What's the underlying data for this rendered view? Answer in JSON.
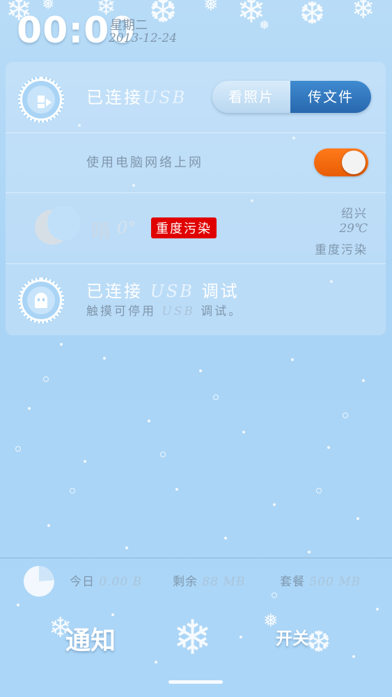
{
  "status": {
    "time": "00:00",
    "weekday": "星期二",
    "date": "2013-12-24"
  },
  "usb": {
    "label_cn": "已连接",
    "label_usb": "USB",
    "tab_photos": "看照片",
    "tab_files": "传文件",
    "selected_tab": "传文件"
  },
  "network": {
    "label": "使用电脑网络上网",
    "toggle_on": true
  },
  "weather": {
    "condition": "晴",
    "temperature": "0°",
    "aqi_badge": "重度污染",
    "city": "绍兴",
    "city_temp": "29℃",
    "city_aqi": "重度污染"
  },
  "debug": {
    "title_cn": "已连接",
    "title_usb": "USB",
    "title_tail": "调试",
    "subtitle_a": "触摸可停用",
    "subtitle_usb": "USB",
    "subtitle_b": "调试。"
  },
  "traffic": {
    "today_label": "今日",
    "today_value": "0.00 B",
    "remain_label": "剩余",
    "remain_value": "88 MB",
    "plan_label": "套餐",
    "plan_value": "500 MB",
    "used_fraction": 0.24
  },
  "nav": {
    "notify": "通知",
    "switch": "开关"
  },
  "colors": {
    "toggle_on": "#f26b0c",
    "selected_tab": "#2f76bf",
    "aqi_red": "#e00000"
  },
  "icons": [
    "snowflake-icon",
    "usb-transfer-icon",
    "moon-icon",
    "ghost-debug-icon"
  ]
}
